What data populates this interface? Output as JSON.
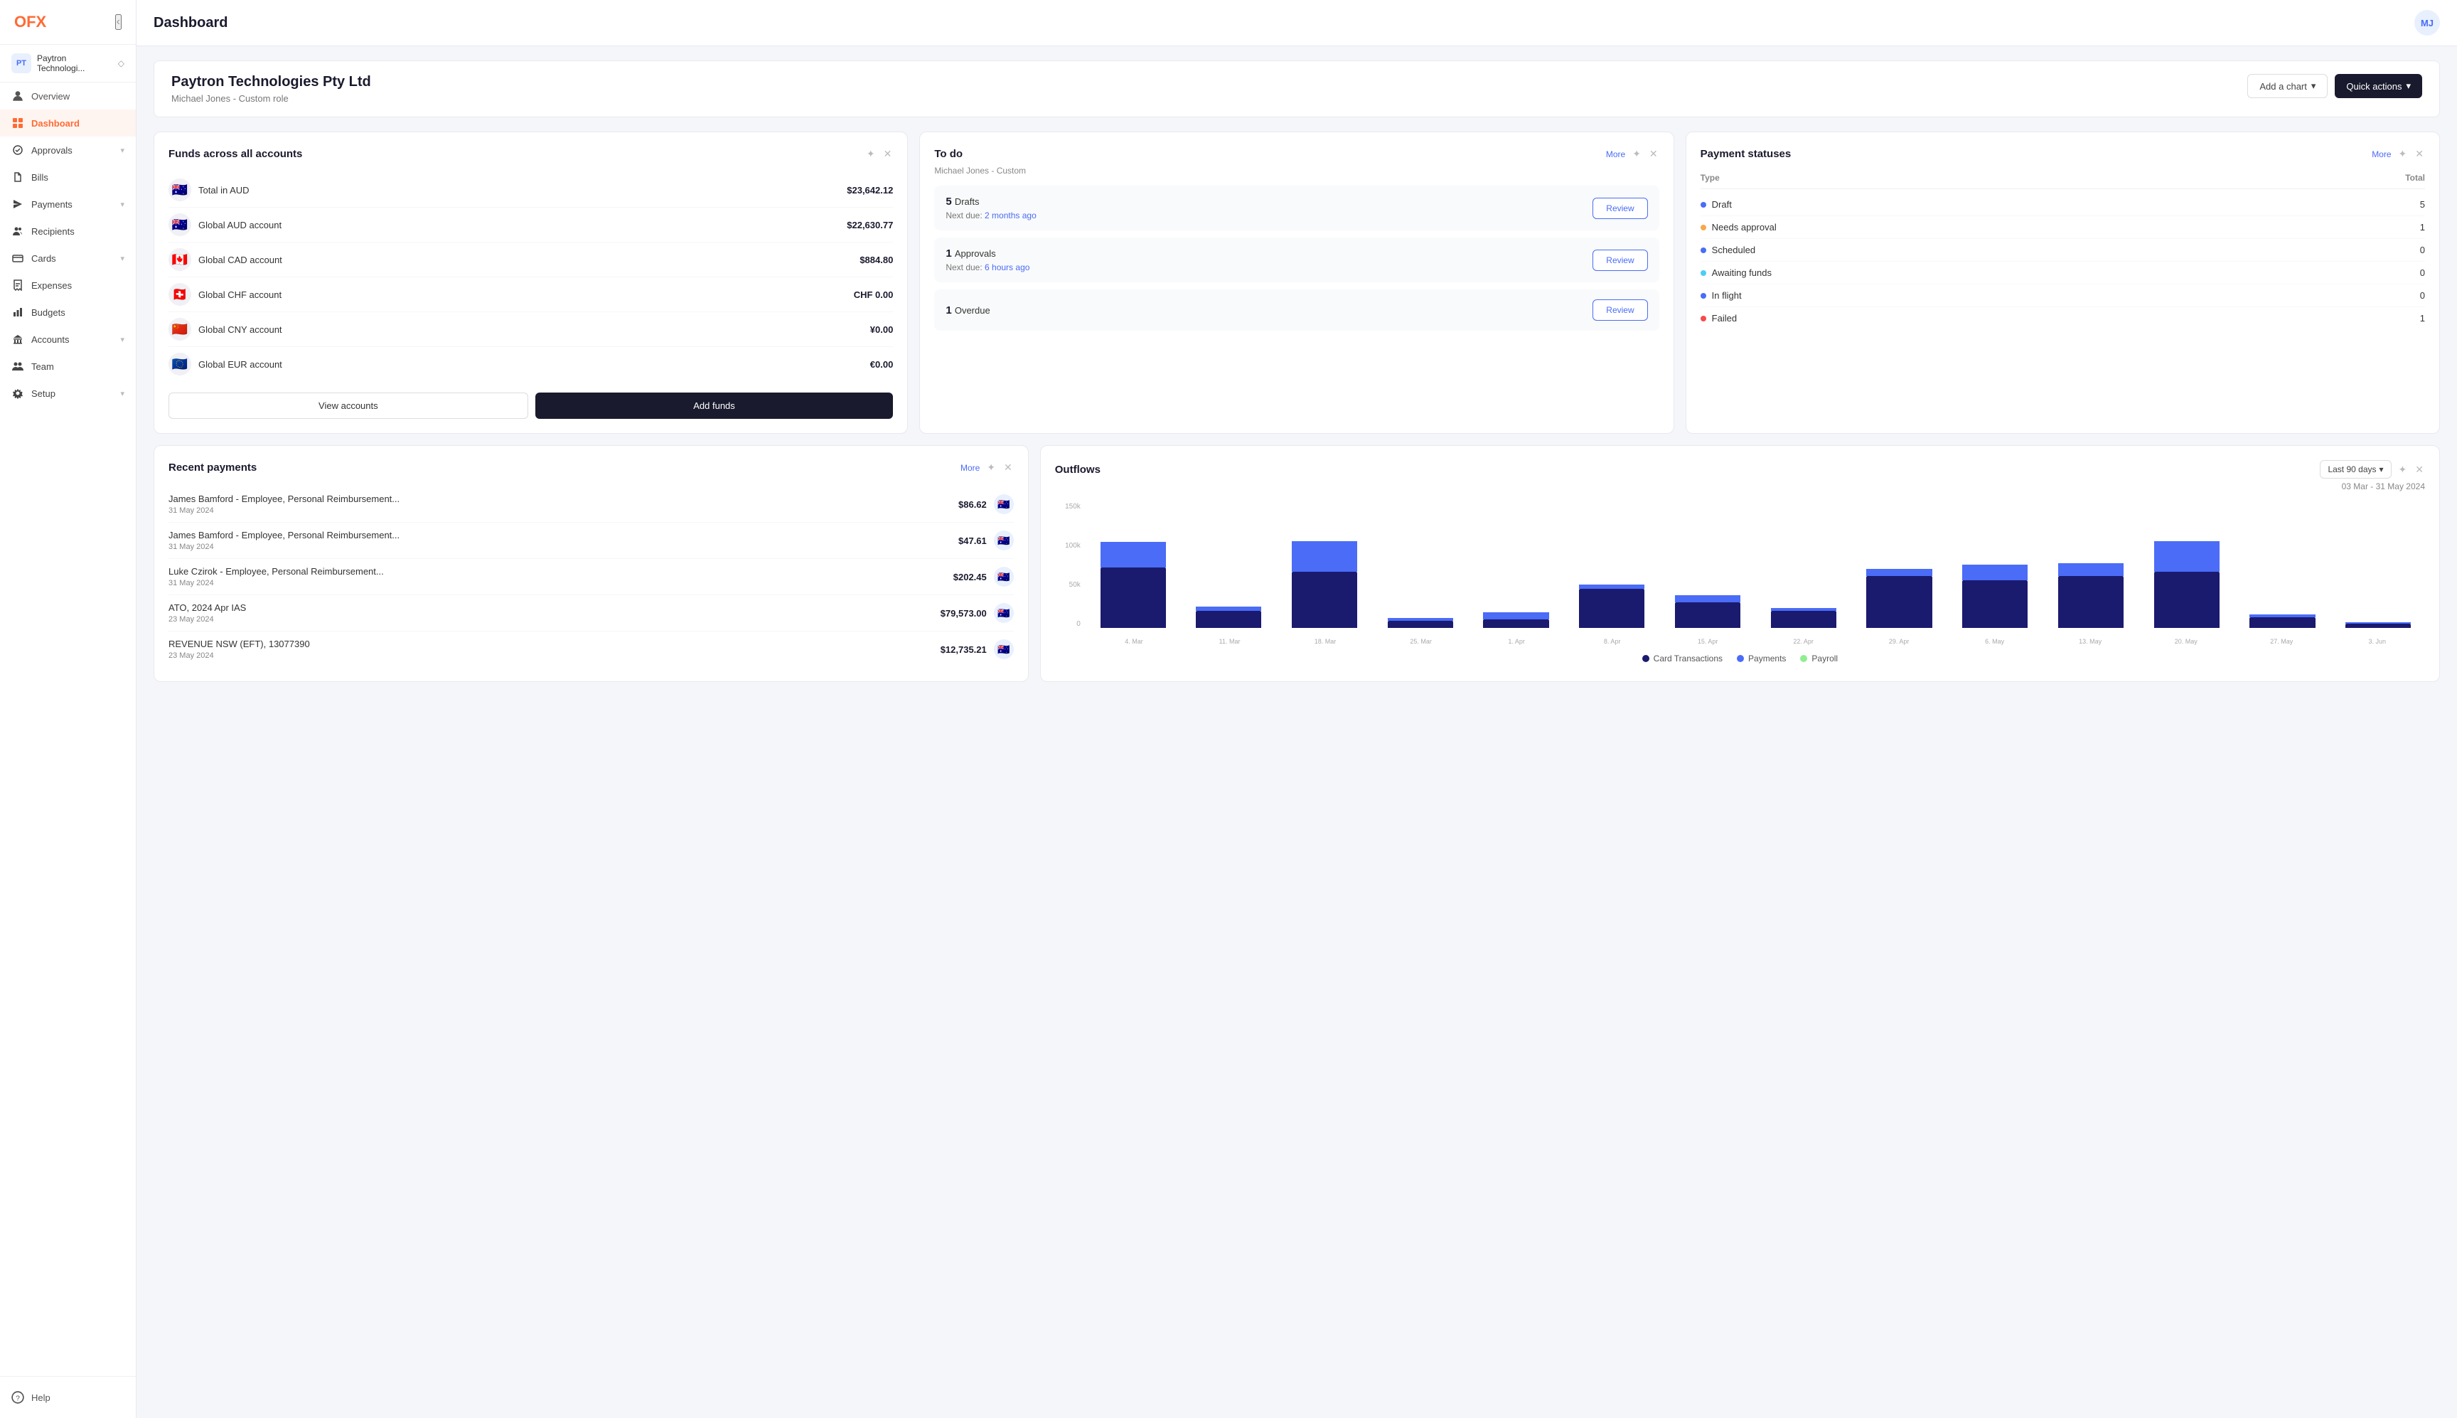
{
  "app": {
    "logo": "OFX",
    "title": "Dashboard",
    "avatar_initials": "MJ"
  },
  "sidebar": {
    "org_name": "Paytron Technologi...",
    "overview_label": "Overview",
    "items": [
      {
        "id": "dashboard",
        "label": "Dashboard",
        "icon": "grid-icon",
        "active": true,
        "has_chevron": false
      },
      {
        "id": "approvals",
        "label": "Approvals",
        "icon": "check-circle-icon",
        "active": false,
        "has_chevron": true
      },
      {
        "id": "bills",
        "label": "Bills",
        "icon": "file-icon",
        "active": false,
        "has_chevron": false
      },
      {
        "id": "payments",
        "label": "Payments",
        "icon": "send-icon",
        "active": false,
        "has_chevron": true
      },
      {
        "id": "recipients",
        "label": "Recipients",
        "icon": "users-icon",
        "active": false,
        "has_chevron": false
      },
      {
        "id": "cards",
        "label": "Cards",
        "icon": "card-icon",
        "active": false,
        "has_chevron": true
      },
      {
        "id": "expenses",
        "label": "Expenses",
        "icon": "receipt-icon",
        "active": false,
        "has_chevron": false
      },
      {
        "id": "budgets",
        "label": "Budgets",
        "icon": "chart-icon",
        "active": false,
        "has_chevron": false
      },
      {
        "id": "accounts",
        "label": "Accounts",
        "icon": "bank-icon",
        "active": false,
        "has_chevron": true
      },
      {
        "id": "team",
        "label": "Team",
        "icon": "team-icon",
        "active": false,
        "has_chevron": false
      },
      {
        "id": "setup",
        "label": "Setup",
        "icon": "gear-icon",
        "active": false,
        "has_chevron": true
      }
    ],
    "help_label": "Help"
  },
  "company": {
    "name": "Paytron Technologies Pty Ltd",
    "subtitle": "Michael Jones - Custom role",
    "add_chart_label": "Add a chart",
    "quick_actions_label": "Quick actions"
  },
  "funds_widget": {
    "title": "Funds across all accounts",
    "accounts": [
      {
        "name": "Total in AUD",
        "amount": "$23,642.12",
        "flag": "🇦🇺"
      },
      {
        "name": "Global AUD account",
        "amount": "$22,630.77",
        "flag": "🇦🇺"
      },
      {
        "name": "Global CAD account",
        "amount": "$884.80",
        "flag": "🇨🇦"
      },
      {
        "name": "Global CHF account",
        "amount": "CHF 0.00",
        "flag": "🇨🇭"
      },
      {
        "name": "Global CNY account",
        "amount": "¥0.00",
        "flag": "🇨🇳"
      },
      {
        "name": "Global EUR account",
        "amount": "€0.00",
        "flag": "🇪🇺"
      }
    ],
    "view_accounts_label": "View accounts",
    "add_funds_label": "Add funds"
  },
  "todo_widget": {
    "title": "To do",
    "subtitle": "Michael Jones - Custom",
    "more_label": "More",
    "items": [
      {
        "count": 5,
        "label": "Drafts",
        "due_label": "Next due:",
        "due_value": "2 months ago",
        "review_label": "Review"
      },
      {
        "count": 1,
        "label": "Approvals",
        "due_label": "Next due:",
        "due_value": "6 hours ago",
        "review_label": "Review"
      },
      {
        "count": 1,
        "label": "Overdue",
        "due_label": "",
        "due_value": "",
        "review_label": "Review"
      }
    ]
  },
  "payment_statuses": {
    "title": "Payment statuses",
    "more_label": "More",
    "headers": {
      "type": "Type",
      "total": "Total"
    },
    "statuses": [
      {
        "label": "Draft",
        "count": 5,
        "color": "#4a6cf7"
      },
      {
        "label": "Needs approval",
        "count": 1,
        "color": "#f7a94a"
      },
      {
        "label": "Scheduled",
        "count": 0,
        "color": "#4a6cf7"
      },
      {
        "label": "Awaiting funds",
        "count": 0,
        "color": "#4acdf7"
      },
      {
        "label": "In flight",
        "count": 0,
        "color": "#4a6cf7"
      },
      {
        "label": "Failed",
        "count": 1,
        "color": "#f74a4a"
      }
    ]
  },
  "recent_payments": {
    "title": "Recent payments",
    "more_label": "More",
    "payments": [
      {
        "name": "James Bamford - Employee, Personal Reimbursement...",
        "date": "31 May 2024",
        "amount": "$86.62",
        "flag": "🇦🇺"
      },
      {
        "name": "James Bamford - Employee, Personal Reimbursement...",
        "date": "31 May 2024",
        "amount": "$47.61",
        "flag": "🇦🇺"
      },
      {
        "name": "Luke Czirok - Employee, Personal Reimbursement...",
        "date": "31 May 2024",
        "amount": "$202.45",
        "flag": "🇦🇺"
      },
      {
        "name": "ATO, 2024 Apr IAS",
        "date": "23 May 2024",
        "amount": "$79,573.00",
        "flag": "🇦🇺"
      },
      {
        "name": "REVENUE NSW (EFT), 13077390",
        "date": "23 May 2024",
        "amount": "$12,735.21",
        "flag": "🇦🇺"
      }
    ]
  },
  "outflows": {
    "title": "Outflows",
    "date_filter_label": "Last 90 days",
    "date_range": "03 Mar - 31 May 2024",
    "y_labels": [
      "150k",
      "100k",
      "50k",
      "0"
    ],
    "x_labels": [
      "4. Mar",
      "11. Mar",
      "18. Mar",
      "25. Mar",
      "1. Apr",
      "8. Apr",
      "15. Apr",
      "22. Apr",
      "29. Apr",
      "6. May",
      "13. May",
      "20. May",
      "27. May",
      "3. Jun"
    ],
    "legend": [
      {
        "label": "Card Transactions",
        "color": "#1a1a6e"
      },
      {
        "label": "Payments",
        "color": "#4a6cf7"
      },
      {
        "label": "Payroll",
        "color": "#90ee90"
      }
    ],
    "bars": [
      {
        "card": 70,
        "payments": 30,
        "payroll": 0
      },
      {
        "card": 20,
        "payments": 5,
        "payroll": 0
      },
      {
        "card": 65,
        "payments": 35,
        "payroll": 0
      },
      {
        "card": 8,
        "payments": 3,
        "payroll": 0
      },
      {
        "card": 10,
        "payments": 8,
        "payroll": 0
      },
      {
        "card": 45,
        "payments": 5,
        "payroll": 0
      },
      {
        "card": 30,
        "payments": 8,
        "payroll": 0
      },
      {
        "card": 20,
        "payments": 3,
        "payroll": 0
      },
      {
        "card": 60,
        "payments": 8,
        "payroll": 0
      },
      {
        "card": 55,
        "payments": 18,
        "payroll": 0
      },
      {
        "card": 60,
        "payments": 15,
        "payroll": 0
      },
      {
        "card": 65,
        "payments": 35,
        "payroll": 0
      },
      {
        "card": 12,
        "payments": 3,
        "payroll": 0
      },
      {
        "card": 5,
        "payments": 2,
        "payroll": 0
      }
    ]
  }
}
